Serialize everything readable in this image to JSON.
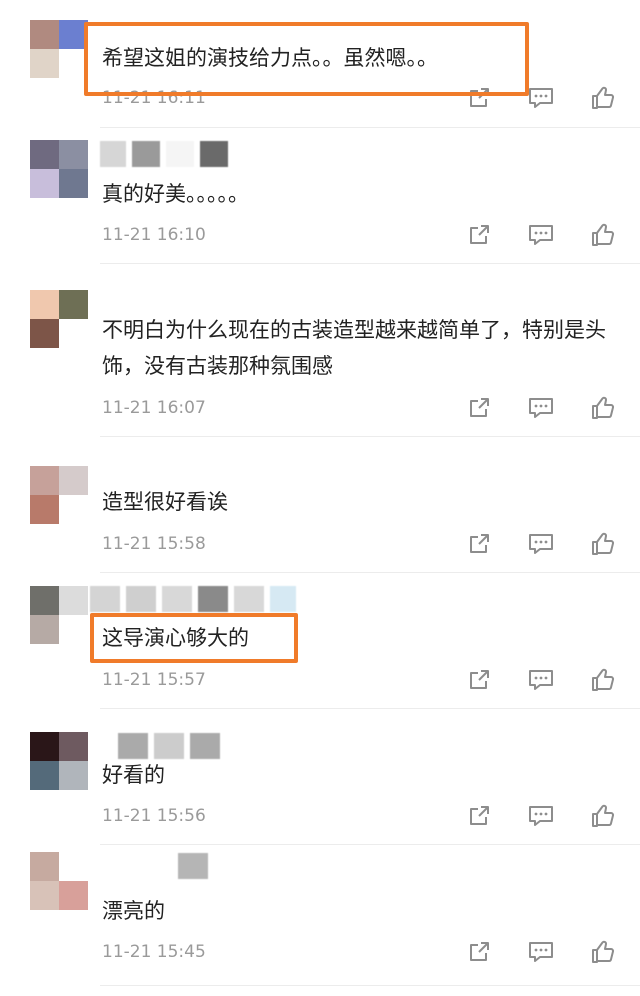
{
  "comments": [
    {
      "text": "希望这姐的演技给力点。。虽然嗯。。",
      "time": "11-21 16:11",
      "avatar_colors": [
        "#b08a80",
        "#6b7fd0",
        "#e0d4c8",
        "#ffffff"
      ],
      "nick_colors": []
    },
    {
      "text": "真的好美。。。。。",
      "time": "11-21 16:10",
      "avatar_colors": [
        "#6f6a80",
        "#8b8fa2",
        "#c8bedb",
        "#6f7890"
      ],
      "nick_colors": [
        "#d6d6d6",
        "#9a9a9a",
        "#f5f5f5",
        "#6a6a6a"
      ]
    },
    {
      "text": "不明白为什么现在的古装造型越来越简单了，特别是头饰，没有古装那种氛围感",
      "time": "11-21 16:07",
      "avatar_colors": [
        "#f0c8ae",
        "#6e6f55",
        "#7d5548",
        "#ffffff"
      ],
      "nick_colors": []
    },
    {
      "text": "造型很好看诶",
      "time": "11-21 15:58",
      "avatar_colors": [
        "#c6a19a",
        "#d5cbcb",
        "#b87a6a",
        "#ffffff"
      ],
      "nick_colors": []
    },
    {
      "text": "这导演心够大的",
      "time": "11-21 15:57",
      "avatar_colors": [
        "#6f6f6a",
        "#dcdcdc",
        "#b6aaa5",
        "#ffffff"
      ],
      "nick_colors": [
        "#d4d4d4",
        "#cfcfcf",
        "#d8d8d8",
        "#8a8a8a",
        "#d8d8d8",
        "#d6e9f3"
      ]
    },
    {
      "text": "好看的",
      "time": "11-21 15:56",
      "avatar_colors": [
        "#2a1618",
        "#6e5a60",
        "#546a7a",
        "#b0b5bb"
      ],
      "nick_colors": [
        "#aaaaaa",
        "#cccccc",
        "#aaaaaa"
      ]
    },
    {
      "text": "漂亮的",
      "time": "11-21 15:45",
      "avatar_colors": [
        "#c6aaa0",
        "#ffffff",
        "#d8c2b8",
        "#d8a09a"
      ],
      "nick_colors": [
        "#b5b5b5"
      ]
    }
  ],
  "icons": {
    "share": "share-icon",
    "reply": "comment-icon",
    "like": "thumbs-up-icon"
  },
  "colors": {
    "highlight": "#f07b2a",
    "time": "#9a9a9a",
    "icon": "#8d8d8d"
  }
}
